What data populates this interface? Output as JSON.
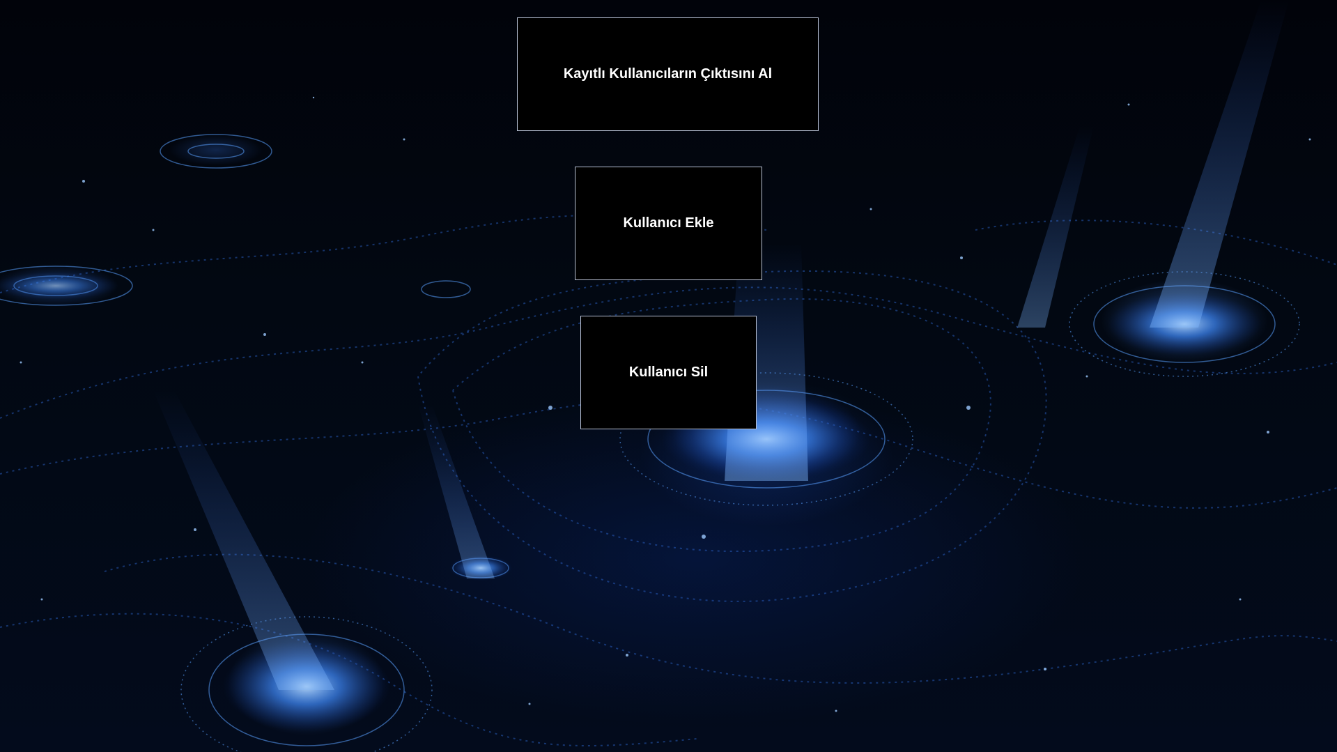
{
  "menu": {
    "export_label": "Kayıtlı Kullanıcıların Çıktısını Al",
    "add_label": "Kullanıcı Ekle",
    "delete_label": "Kullanıcı Sil"
  },
  "colors": {
    "button_bg": "#000000",
    "button_text": "#ffffff",
    "button_border": "#b9c2d6",
    "background_glow": "#3f8cff"
  },
  "background": {
    "type": "blue-fractal-wallpaper"
  }
}
